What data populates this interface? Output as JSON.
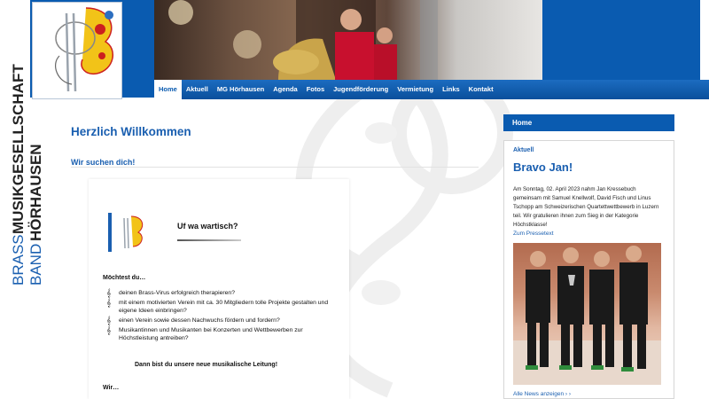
{
  "brand": {
    "line1": "BRASS",
    "line1b": "MUSIKGESELLSCHAFT",
    "line2": "BAND",
    "line2b": "HÖRHAUSEN"
  },
  "nav": {
    "items": [
      "Home",
      "Aktuell",
      "MG Hörhausen",
      "Agenda",
      "Fotos",
      "Jugendförderung",
      "Vermietung",
      "Links",
      "Kontakt"
    ],
    "active_index": 0
  },
  "main": {
    "title": "Herzlich Willkommen",
    "subtitle": "Wir suchen dich!"
  },
  "flyer": {
    "slogan": "Uf wa wartisch?",
    "question_head": "Möchtest du…",
    "questions": [
      "deinen Brass-Virus erfolgreich therapieren?",
      "mit einem motivierten Verein mit ca. 30 Mitgliedern tolle Projekte gestalten und eigene Ideen einbringen?",
      "einen Verein sowie dessen Nachwuchs fördern und fordern?",
      "Musikantinnen und Musikanten bei Konzerten und Wettbewerben zur Höchstleistung antreiben?"
    ],
    "cta": "Dann bist du unsere neue musikalische Leitung!",
    "wir": "Wir…"
  },
  "sidebar": {
    "home_label": "Home",
    "category": "Aktuell",
    "headline": "Bravo Jan!",
    "text": "Am Sonntag, 02. April 2023 nahm Jan Kressebuch gemeinsam mit Samuel Knellwolf, David Fisch und Linus Tschopp am Schweizerischen Quartettwettbewerb in Luzern teil. Wir gratulieren ihnen zum Sieg in der Kategorie Höchstklasse!",
    "presse_link": "Zum Pressetext",
    "more_link": "Alle News anzeigen  ›  ›"
  },
  "colors": {
    "brand_blue": "#0a5bb0",
    "link_blue": "#1a5fb0"
  }
}
